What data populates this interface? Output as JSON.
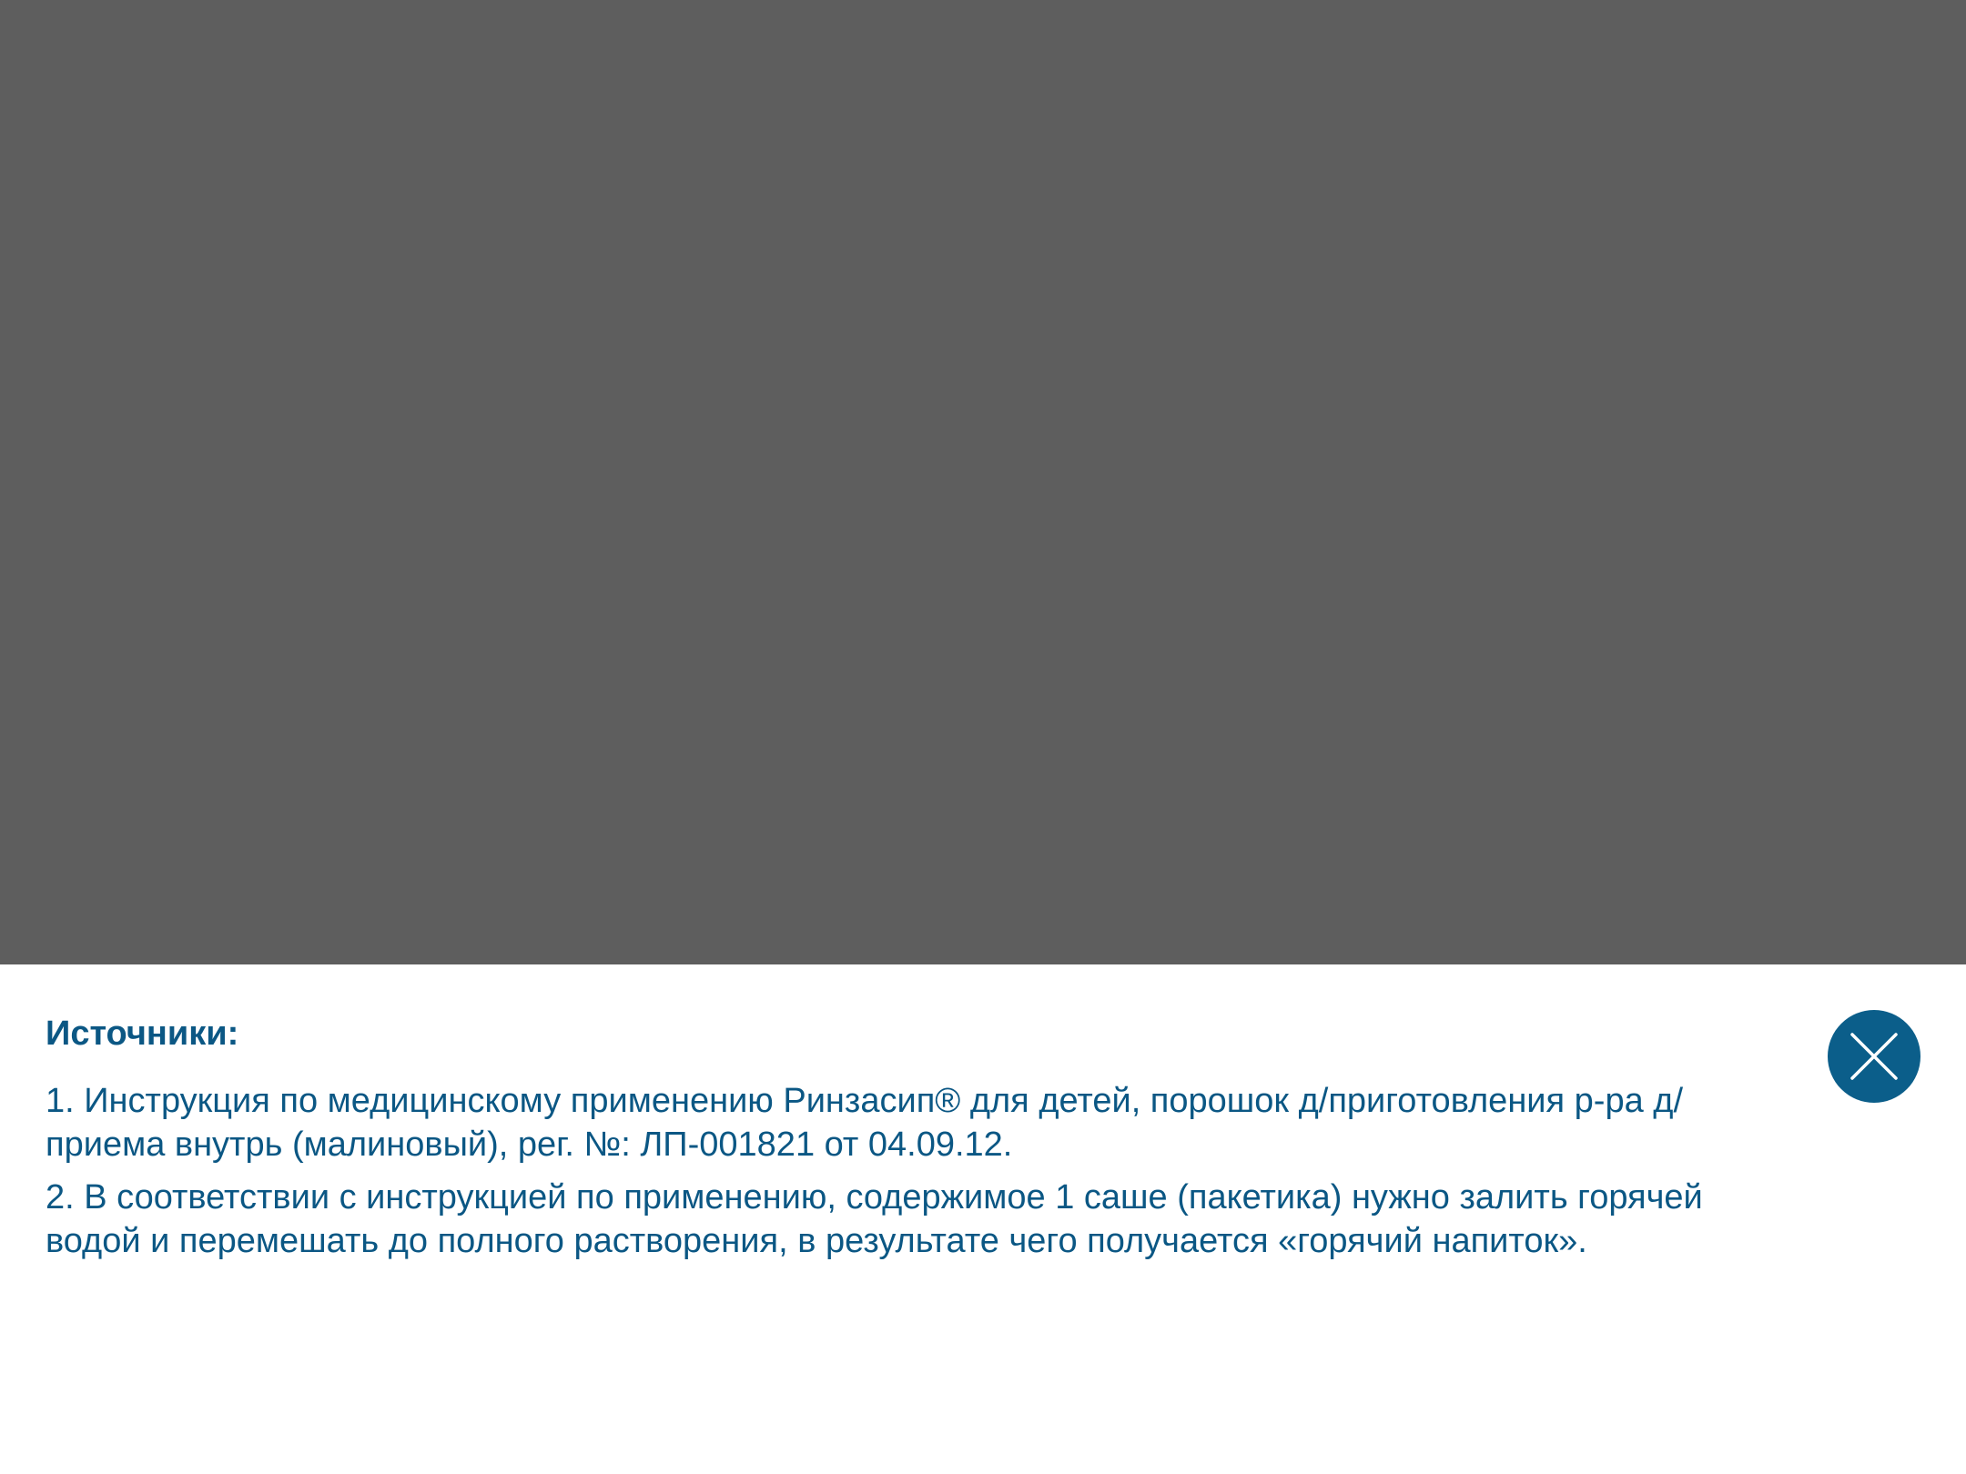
{
  "sources": {
    "title": "Источники:",
    "items": [
      "1. Инструкция по медицинскому применению Ринзасип® для детей, порошок д/приготовления р-ра д/приема внутрь (малиновый), рег. №: ЛП-001821 от 04.09.12.",
      "2. В соответствии с инструкцией по применению, содержимое 1 саше (пакетика) нужно залить горячей водой и перемешать до полного растворения, в результате чего получается «горячий напиток»."
    ]
  },
  "close_button": {
    "icon": "close-icon"
  },
  "colors": {
    "overlay": "#5e5e5e",
    "sheet": "#ffffff",
    "accent": "#0b5784",
    "button": "#0b5e8a"
  }
}
